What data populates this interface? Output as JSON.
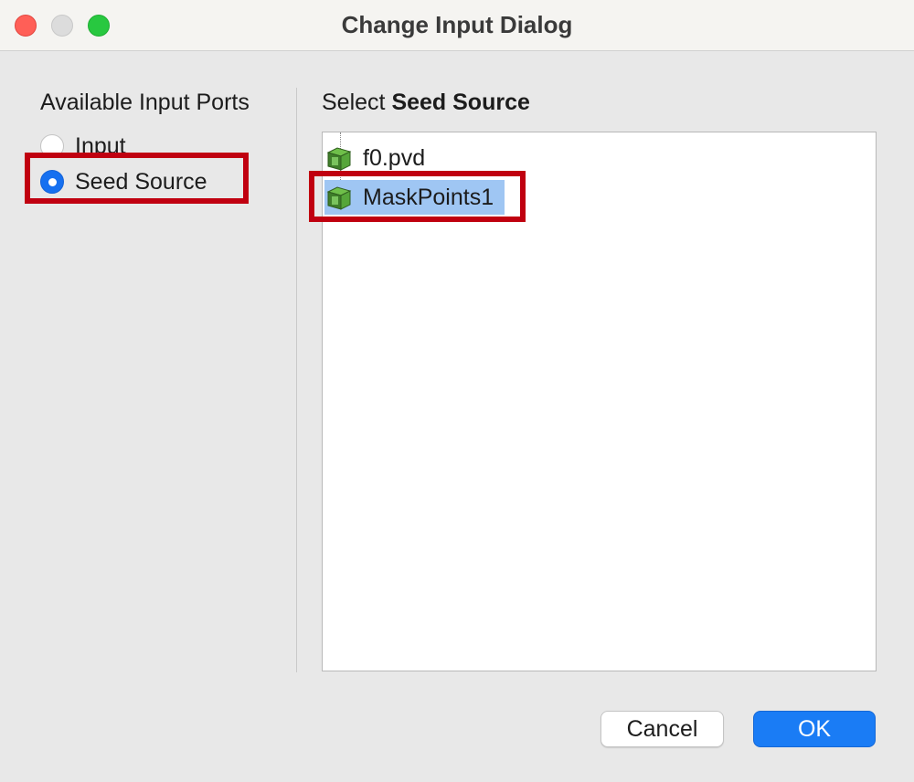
{
  "window": {
    "title": "Change Input Dialog"
  },
  "left_panel": {
    "heading": "Available Input Ports",
    "options": [
      {
        "label": "Input",
        "checked": false
      },
      {
        "label": "Seed Source",
        "checked": true
      }
    ]
  },
  "right_panel": {
    "heading_prefix": "Select",
    "heading_bold": "Seed Source",
    "items": [
      {
        "label": "f0.pvd",
        "icon": "green-cube-icon",
        "selected": false
      },
      {
        "label": "MaskPoints1",
        "icon": "green-cube-icon",
        "selected": true
      }
    ]
  },
  "buttons": {
    "cancel": "Cancel",
    "ok": "OK"
  },
  "colors": {
    "accent": "#1a7cf5",
    "highlight_box": "#c00010",
    "selection": "#9fc6f3"
  }
}
